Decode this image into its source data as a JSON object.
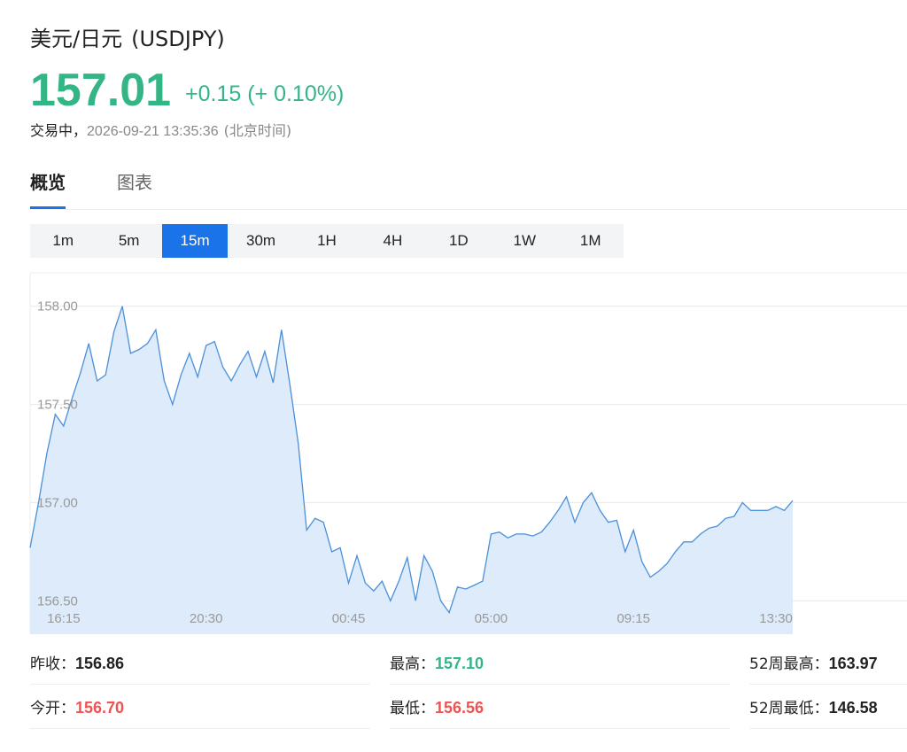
{
  "header": {
    "name": "美元/日元",
    "code": "(USDJPY)",
    "price": "157.01",
    "change": "+0.15 (+ 0.10%)",
    "status": "交易中，",
    "datetime": "2026-09-21 13:35:36",
    "timezone": "(北京时间)"
  },
  "colors": {
    "up": "#33b586",
    "down": "#f05252",
    "accent": "#1a73e8",
    "line": "#4a90d9",
    "fill": "#ddebfb"
  },
  "tabs": [
    {
      "label": "概览",
      "active": true
    },
    {
      "label": "图表",
      "active": false
    }
  ],
  "periods": [
    {
      "label": "1m",
      "active": false
    },
    {
      "label": "5m",
      "active": false
    },
    {
      "label": "15m",
      "active": true
    },
    {
      "label": "30m",
      "active": false
    },
    {
      "label": "1H",
      "active": false
    },
    {
      "label": "4H",
      "active": false
    },
    {
      "label": "1D",
      "active": false
    },
    {
      "label": "1W",
      "active": false
    },
    {
      "label": "1M",
      "active": false
    }
  ],
  "chart_data": {
    "type": "area",
    "y_ticks": [
      "158.00",
      "157.50",
      "157.00",
      "156.50"
    ],
    "y_tick_values": [
      158.0,
      157.5,
      157.0,
      156.5
    ],
    "x_ticks": [
      "16:15",
      "20:30",
      "00:45",
      "05:00",
      "09:15",
      "13:30"
    ],
    "x_tick_index": [
      4,
      21,
      38,
      55,
      72,
      89
    ],
    "ylim": [
      156.33,
      158.17
    ],
    "grid": true,
    "values": [
      156.77,
      157.0,
      157.25,
      157.45,
      157.39,
      157.53,
      157.66,
      157.81,
      157.62,
      157.65,
      157.87,
      158.0,
      157.76,
      157.78,
      157.81,
      157.88,
      157.62,
      157.5,
      157.65,
      157.76,
      157.64,
      157.8,
      157.82,
      157.69,
      157.62,
      157.7,
      157.77,
      157.64,
      157.77,
      157.61,
      157.88,
      157.6,
      157.3,
      156.86,
      156.92,
      156.9,
      156.75,
      156.77,
      156.59,
      156.73,
      156.59,
      156.55,
      156.6,
      156.5,
      156.6,
      156.72,
      156.5,
      156.73,
      156.65,
      156.5,
      156.44,
      156.57,
      156.56,
      156.58,
      156.6,
      156.84,
      156.85,
      156.82,
      156.84,
      156.84,
      156.83,
      156.85,
      156.9,
      156.96,
      157.03,
      156.9,
      157.0,
      157.05,
      156.96,
      156.9,
      156.91,
      156.75,
      156.86,
      156.7,
      156.62,
      156.65,
      156.69,
      156.75,
      156.8,
      156.8,
      156.84,
      156.87,
      156.88,
      156.92,
      156.93,
      157.0,
      156.96,
      156.96,
      156.96,
      156.98,
      156.96,
      157.01
    ]
  },
  "stats": {
    "prev_close_label": "昨收：",
    "prev_close": "156.86",
    "high_label": "最高：",
    "high": "157.10",
    "high52_label": "52周最高：",
    "high52": "163.97",
    "open_label": "今开：",
    "open": "156.70",
    "low_label": "最低：",
    "low": "156.56",
    "low52_label": "52周最低：",
    "low52": "146.58"
  }
}
